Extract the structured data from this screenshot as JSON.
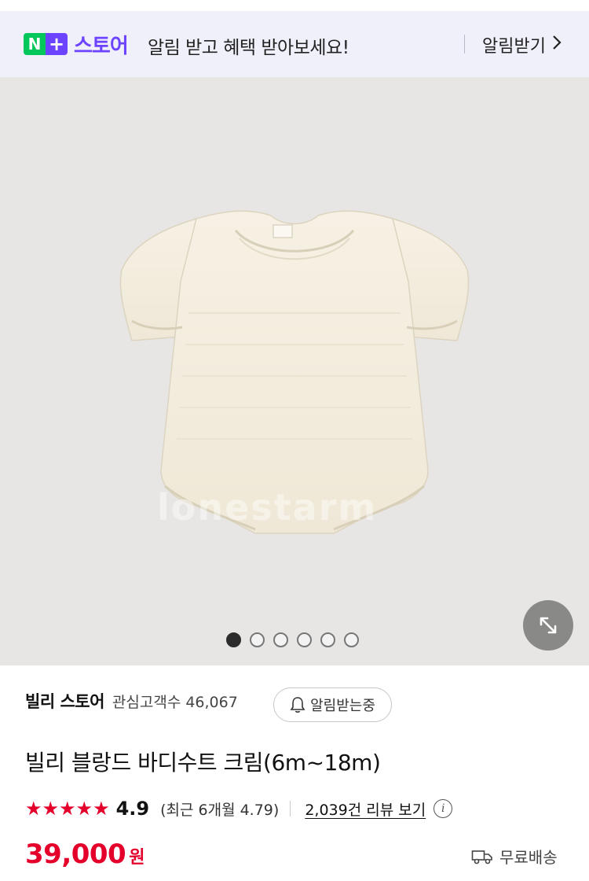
{
  "banner": {
    "logo_n": "N",
    "logo_plus": "+",
    "brand": "스토어",
    "message": "알림 받고 혜택 받아보세요!",
    "action_label": "알림받기",
    "action_icon": "chevron-right-icon",
    "colors": {
      "background": "#f0f0fb",
      "brand": "#6c43ff",
      "n_green": "#03c75a"
    }
  },
  "gallery": {
    "watermark": "lonestarm",
    "image_count": 6,
    "active_index": 0,
    "expand_icon": "expand-icon",
    "background": "#e7e6e4"
  },
  "store": {
    "name": "빌리 스토어",
    "followers_label": "관심고객수",
    "followers_count": "46,067",
    "notify_label": "알림받는중",
    "notify_icon": "bell-icon"
  },
  "product": {
    "title": "빌리 블랑드 바디수트 크림(6m~18m)",
    "stars": "★★★★★",
    "rating": "4.9",
    "recent_rating": "(최근 6개월 4.79)",
    "review_link": "2,039건 리뷰 보기",
    "info_icon": "info-icon",
    "price": "39,000",
    "currency": "원",
    "shipping": "무료배송",
    "shipping_icon": "truck-icon",
    "accent": "#e4002b"
  }
}
